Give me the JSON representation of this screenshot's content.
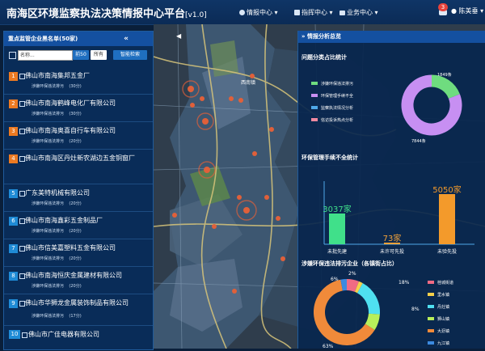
{
  "header": {
    "title": "南海区环境监察执法决策情报中心平台",
    "version": "[v1.0]",
    "nav": [
      {
        "label": "情报中心",
        "icon": "globe-icon"
      },
      {
        "label": "指挥中心",
        "icon": "command-icon"
      },
      {
        "label": "业务中心",
        "icon": "briefcase-icon"
      }
    ],
    "notification_count": "3",
    "user": "陈美垂"
  },
  "left_panel": {
    "title": "重点监管企业黑名单(50家)",
    "collapse": "«",
    "name_placeholder": "名称...",
    "filter_buttons": [
      "前50",
      "所有",
      "智能检索"
    ],
    "companies": [
      {
        "rank": "1",
        "name": "佛山市南海集邦五金厂",
        "sub": "涉嫌环保违法排污",
        "count": "(30分)"
      },
      {
        "rank": "2",
        "name": "佛山市南海鹤峰电化厂有限公司",
        "sub": "涉嫌环保违法排污",
        "count": "(30分)"
      },
      {
        "rank": "3",
        "name": "佛山市南海奥喜自行车有限公司",
        "sub": "涉嫌环保违法排污",
        "count": "(20分)"
      },
      {
        "rank": "4",
        "name": "佛山市南海区丹灶新农湖边五金铜窗厂",
        "sub": "",
        "count": ""
      },
      {
        "rank": "5",
        "name": "广东美特机械有限公司",
        "sub": "涉嫌环保违法排污",
        "count": "(20分)"
      },
      {
        "rank": "6",
        "name": "佛山市南海鑫彩五金制品厂",
        "sub": "涉嫌环保违法排污",
        "count": "(20分)"
      },
      {
        "rank": "7",
        "name": "佛山市信美嘉塑料五金有限公司",
        "sub": "涉嫌环保违法排污",
        "count": "(20分)"
      },
      {
        "rank": "8",
        "name": "佛山市南海恒庆金属建材有限公司",
        "sub": "涉嫌环保违法排污",
        "count": "(20分)"
      },
      {
        "rank": "9",
        "name": "佛山市华狮龙金属装饰制品有限公司",
        "sub": "涉嫌环保违法排污",
        "count": "(17分)"
      },
      {
        "rank": "10",
        "name": "佛山市广佳电器有限公司",
        "sub": "",
        "count": ""
      }
    ]
  },
  "map": {
    "collapse_left": "◀",
    "labels": [
      "西南镇"
    ]
  },
  "right_panel": {
    "title": "情报分析总览",
    "donut_section": "问题分类占比统计",
    "donut_legend": [
      "涉嫌环保违法排污",
      "环保管理手续不全",
      "监察执法情况分析",
      "信访投诉热点分析"
    ],
    "donut_label_top": "1849条",
    "donut_label_bottom": "7844条",
    "bar_section": "环保管理手续不全统计",
    "bars": [
      {
        "label": "未批先建",
        "value_text": "3037家"
      },
      {
        "label": "未许可先投",
        "value_text": "73家"
      },
      {
        "label": "未验先投",
        "value_text": "5050家"
      }
    ],
    "pie_section": "涉嫌环保违法排污企业（各镇街占比）",
    "pie_legend": [
      "桂城街道",
      "里水镇",
      "丹灶镇",
      "狮山镇",
      "大沥镇",
      "九江镇"
    ],
    "pie_labels": [
      "6%",
      "2%",
      "18%",
      "8%",
      "63%"
    ]
  },
  "chart_data": [
    {
      "type": "pie",
      "title": "问题分类占比统计",
      "categories": [
        "涉嫌环保违法排污",
        "环保管理手续不全",
        "监察执法情况分析",
        "信访投诉热点分析"
      ],
      "values": [
        1849,
        7844,
        0,
        0
      ],
      "colors": [
        "#6fdc7f",
        "#c78ff2",
        "#4fa8e8",
        "#f08aa0"
      ]
    },
    {
      "type": "bar",
      "title": "环保管理手续不全统计",
      "categories": [
        "未批先建",
        "未许可先投",
        "未验先投"
      ],
      "values": [
        3037,
        73,
        5050
      ],
      "unit": "家",
      "colors": [
        "#40e08a",
        "#f3a23a",
        "#f39a2b"
      ]
    },
    {
      "type": "pie",
      "title": "涉嫌环保违法排污企业（各镇街占比）",
      "categories": [
        "桂城街道",
        "里水镇",
        "丹灶镇",
        "狮山镇",
        "大沥镇",
        "九江镇"
      ],
      "values": [
        6,
        2,
        18,
        8,
        63,
        3
      ],
      "colors": [
        "#f06b84",
        "#f5d04a",
        "#4fe0f0",
        "#b7ef5a",
        "#f08a3a",
        "#3c8ae0"
      ]
    }
  ]
}
